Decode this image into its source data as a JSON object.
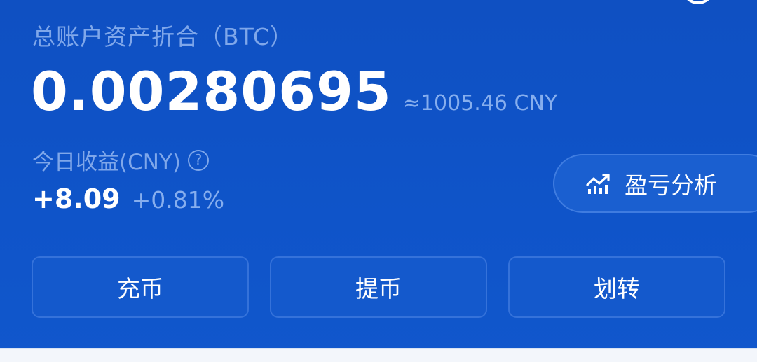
{
  "account": {
    "total_label": "总账户资产折合（BTC）",
    "balance_btc": "0.00280695",
    "balance_approx": "≈1005.46 CNY"
  },
  "today": {
    "label": "今日收益(CNY)",
    "help_symbol": "?",
    "change": "+8.09",
    "percent": "+0.81%"
  },
  "pnl_button": {
    "label": "盈亏分析",
    "icon": "trend-chart-icon"
  },
  "actions": {
    "deposit": "充币",
    "withdraw": "提币",
    "transfer": "划转"
  },
  "colors": {
    "background": "#0f52c4",
    "muted_text": "#7fa7ea",
    "primary_text": "#ffffff"
  }
}
